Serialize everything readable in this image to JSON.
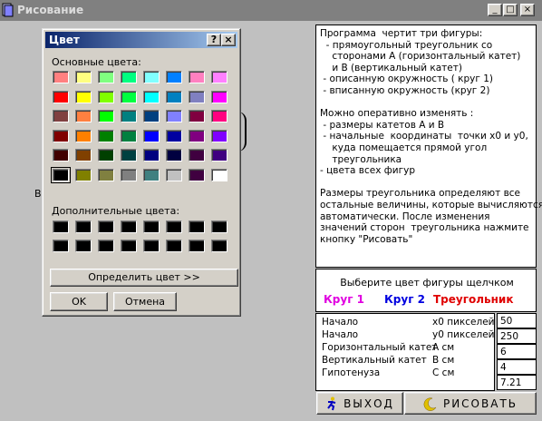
{
  "window": {
    "title": "Рисование",
    "min_label": "_",
    "max_label": "□",
    "close_label": "×"
  },
  "canvas": {
    "label_B": "B"
  },
  "dialog": {
    "title": "Цвет",
    "help_label": "?",
    "close_label": "×",
    "basic_label": "Основные цвета:",
    "custom_label": "Дополнительные цвета:",
    "define_label": "Определить цвет >>",
    "ok_label": "OK",
    "cancel_label": "Отмена",
    "basic_colors": [
      [
        "#ff8080",
        "#ffff80",
        "#80ff80",
        "#00ff80",
        "#80ffff",
        "#0080ff",
        "#ff80c0",
        "#ff80ff"
      ],
      [
        "#ff0000",
        "#ffff00",
        "#80ff00",
        "#00ff40",
        "#00ffff",
        "#0080c0",
        "#8080c0",
        "#ff00ff"
      ],
      [
        "#804040",
        "#ff8040",
        "#00ff00",
        "#008080",
        "#004080",
        "#8080ff",
        "#800040",
        "#ff0080"
      ],
      [
        "#800000",
        "#ff8000",
        "#008000",
        "#008040",
        "#0000ff",
        "#0000a0",
        "#800080",
        "#8000ff"
      ],
      [
        "#400000",
        "#804000",
        "#004000",
        "#004040",
        "#000080",
        "#000040",
        "#400040",
        "#400080"
      ],
      [
        "#000000",
        "#808000",
        "#808040",
        "#808080",
        "#408080",
        "#c0c0c0",
        "#400040",
        "#ffffff"
      ]
    ],
    "custom_colors": [
      [
        "#000000",
        "#000000",
        "#000000",
        "#000000",
        "#000000",
        "#000000",
        "#000000",
        "#000000"
      ],
      [
        "#000000",
        "#000000",
        "#000000",
        "#000000",
        "#000000",
        "#000000",
        "#000000",
        "#000000"
      ]
    ]
  },
  "info": {
    "text": "Программа  чертит три фигуры:\n  - прямоугольный треугольник со\n    сторонами А (горизонтальный катет)\n    и В (вертикальный катет)\n - описанную окружность ( круг 1)\n - вписанную окружность (круг 2)\n\nМожно оперативно изменять :\n - размеры катетов А и В\n - начальные  координаты  точки х0 и у0,\n    куда помещается прямой угол\n    треугольника\n- цвета всех фигур\n\nРазмеры треугольника определяют все\nостальные величины, которые вычисляются\nавтоматически. После изменения\nзначений сторон  треугольника нажмите\nкнопку \"Рисовать\""
  },
  "color_select": {
    "prompt": "Выберите цвет фигуры щелчком",
    "circle1": "Круг 1",
    "circle2": "Круг 2",
    "triangle": "Треугольник"
  },
  "params": [
    {
      "label": "Начало",
      "unit": "x0 пикселей",
      "value": "50"
    },
    {
      "label": "Начало",
      "unit": "y0 пикселей",
      "value": "250"
    },
    {
      "label": "Горизонтальный катет",
      "unit": "A см",
      "value": "6"
    },
    {
      "label": "Вертикальный катет",
      "unit": "B см",
      "value": "4"
    },
    {
      "label": "Гипотенуза",
      "unit": "C см",
      "value": "7.21"
    }
  ],
  "buttons": {
    "exit": "ВЫХОД",
    "draw": "РИСОВАТЬ"
  }
}
